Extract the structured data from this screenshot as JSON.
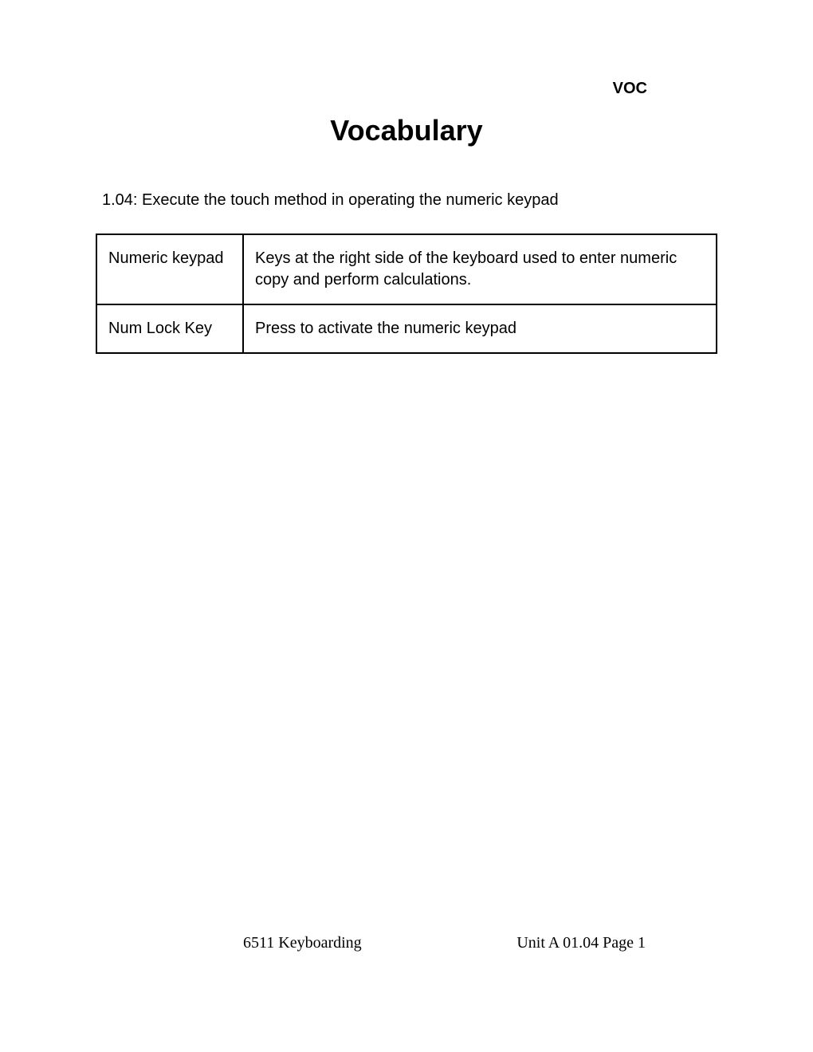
{
  "header_label": "VOC",
  "title": "Vocabulary",
  "objective": "1.04:  Execute the touch method in operating the numeric keypad",
  "vocab": [
    {
      "term": "Numeric keypad",
      "definition": "Keys at the right side of the keyboard used to enter numeric copy and perform calculations."
    },
    {
      "term": "Num Lock Key",
      "definition": "Press to activate the numeric keypad"
    }
  ],
  "footer": {
    "course": "6511 Keyboarding",
    "unit_page": "Unit A    01.04    Page 1"
  }
}
